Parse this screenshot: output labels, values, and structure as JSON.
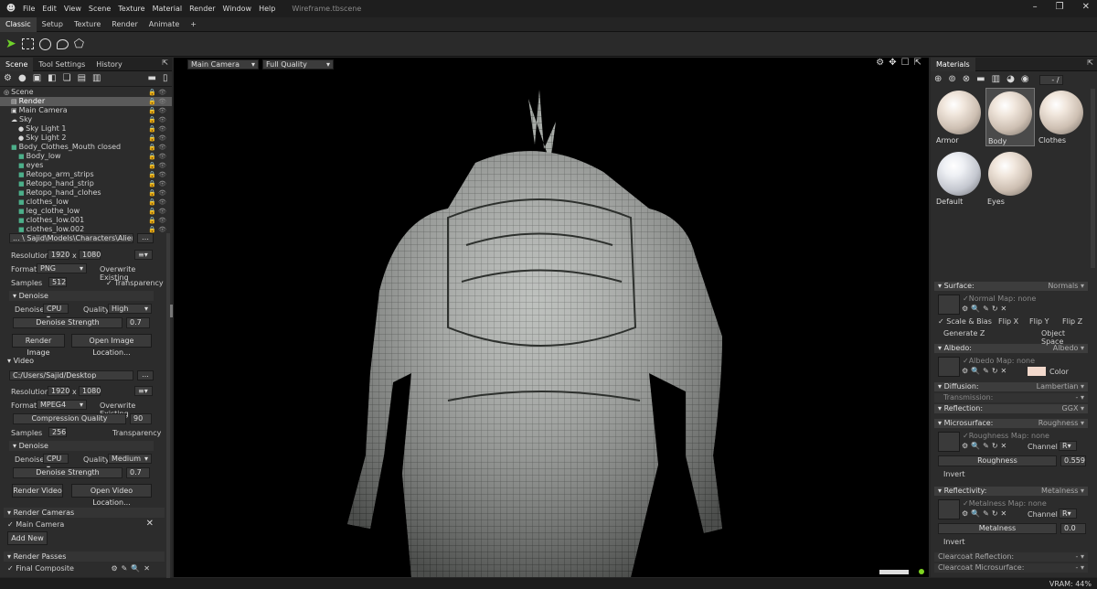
{
  "app": {
    "title": "Wireframe.tbscene",
    "menu": [
      "File",
      "Edit",
      "View",
      "Scene",
      "Texture",
      "Material",
      "Render",
      "Window",
      "Help"
    ]
  },
  "top_tabs": [
    "Classic",
    "Setup",
    "Texture",
    "Render",
    "Animate",
    "+"
  ],
  "left": {
    "tabs": [
      "Scene",
      "Tool Settings",
      "History"
    ],
    "tree": [
      {
        "label": "Scene",
        "indent": 0,
        "icon": "scene-icon"
      },
      {
        "label": "Render",
        "indent": 1,
        "icon": "render-icon",
        "sel": true
      },
      {
        "label": "Main Camera",
        "indent": 1,
        "icon": "camera-icon"
      },
      {
        "label": "Sky",
        "indent": 1,
        "icon": "sky-icon"
      },
      {
        "label": "Sky Light 1",
        "indent": 2,
        "icon": "light-icon"
      },
      {
        "label": "Sky Light 2",
        "indent": 2,
        "icon": "light-icon"
      },
      {
        "label": "Body_Clothes_Mouth closed",
        "indent": 1,
        "icon": "mesh-icon"
      },
      {
        "label": "Body_low",
        "indent": 2,
        "icon": "mesh-icon"
      },
      {
        "label": "eyes",
        "indent": 2,
        "icon": "mesh-icon"
      },
      {
        "label": "Retopo_arm_strips",
        "indent": 2,
        "icon": "mesh-icon"
      },
      {
        "label": "Retopo_hand_strip",
        "indent": 2,
        "icon": "mesh-icon"
      },
      {
        "label": "Retopo_hand_clohes",
        "indent": 2,
        "icon": "mesh-icon"
      },
      {
        "label": "clothes_low",
        "indent": 2,
        "icon": "mesh-icon"
      },
      {
        "label": "leg_clothe_low",
        "indent": 2,
        "icon": "mesh-icon"
      },
      {
        "label": "clothes_low.001",
        "indent": 2,
        "icon": "mesh-icon"
      },
      {
        "label": "clothes_low.002",
        "indent": 2,
        "icon": "mesh-icon"
      }
    ],
    "image": {
      "path_partial": "... \\ Sajid\\Models\\Characters\\Alien\\Sur...",
      "resolution_label": "Resolution:",
      "res_w": "1920",
      "x": "x",
      "res_h": "1080",
      "format_label": "Format",
      "format": "PNG",
      "overwrite": "Overwrite Existing",
      "samples_label": "Samples",
      "samples": "512",
      "transparency": "Transparency",
      "denoise_head": "Denoise",
      "denoise_label": "Denoise",
      "denoise": "CPU",
      "quality_label": "Quality",
      "quality": "High",
      "strength_label": "Denoise Strength",
      "strength": "0.7",
      "render_btn": "Render Image",
      "open_btn": "Open Image Location..."
    },
    "video": {
      "head": "Video",
      "path": "C:/Users/Sajid/Desktop",
      "dots": "...",
      "resolution_label": "Resolution:",
      "res_w": "1920",
      "x": "x",
      "res_h": "1080",
      "format_label": "Format",
      "format": "MPEG4",
      "overwrite": "Overwrite Existing",
      "compression_label": "Compression Quality",
      "compression": "90",
      "samples_label": "Samples",
      "samples": "256",
      "transparency": "Transparency",
      "denoise_head": "Denoise",
      "denoise_label": "Denoise",
      "denoise": "CPU",
      "quality_label": "Quality",
      "quality": "Medium",
      "strength_label": "Denoise Strength",
      "strength": "0.7",
      "render_btn": "Render Video",
      "open_btn": "Open Video Location..."
    },
    "cameras": {
      "head": "Render Cameras",
      "item": "Main Camera",
      "add": "Add New"
    },
    "passes": {
      "head": "Render Passes",
      "item": "Final Composite"
    }
  },
  "viewport": {
    "camera": "Main Camera",
    "quality": "Full Quality"
  },
  "materials": {
    "tab": "Materials",
    "counter": "- /",
    "items": [
      {
        "name": "Armor"
      },
      {
        "name": "Body",
        "sel": true
      },
      {
        "name": "Clothes"
      },
      {
        "name": "Default",
        "def": true
      },
      {
        "name": "Eyes"
      }
    ]
  },
  "props": {
    "surface": {
      "label": "Surface:",
      "value": "Normals",
      "map": "Normal Map:",
      "map_val": "none",
      "scale_bias": "Scale & Bias",
      "flip_x": "Flip X",
      "flip_y": "Flip Y",
      "flip_z": "Flip Z",
      "gen_z": "Generate Z",
      "obj_space": "Object Space"
    },
    "albedo": {
      "label": "Albedo:",
      "value": "Albedo",
      "map": "Albedo Map:",
      "map_val": "none",
      "color_label": "Color",
      "color": "#f2d9cc"
    },
    "diffusion": {
      "label": "Diffusion:",
      "value": "Lambertian",
      "transmission": "Transmission:",
      "trans_val": "-"
    },
    "reflection": {
      "label": "Reflection:",
      "value": "GGX"
    },
    "microsurface": {
      "label": "Microsurface:",
      "value": "Roughness",
      "map": "Roughness Map:",
      "map_val": "none",
      "channel_label": "Channel",
      "channel": "R",
      "slider_label": "Roughness",
      "slider_val": "0.559",
      "invert": "Invert"
    },
    "reflectivity": {
      "label": "Reflectivity:",
      "value": "Metalness",
      "map": "Metalness Map:",
      "map_val": "none",
      "channel_label": "Channel",
      "channel": "R",
      "slider_label": "Metalness",
      "slider_val": "0.0",
      "invert": "Invert"
    },
    "cc_reflection": {
      "label": "Clearcoat Reflection:",
      "value": "-"
    },
    "cc_micro": {
      "label": "Clearcoat Microsurface:",
      "value": "-"
    }
  },
  "status": {
    "vram": "VRAM: 44%"
  }
}
